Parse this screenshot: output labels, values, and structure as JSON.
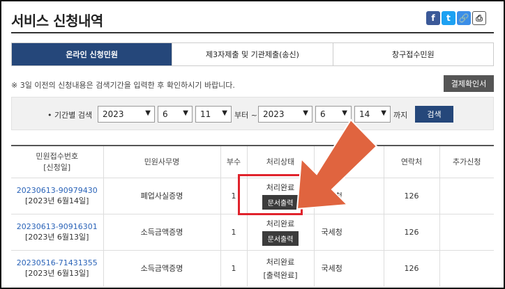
{
  "page": {
    "title": "서비스 신청내역"
  },
  "share": {
    "facebook_icon": "f",
    "twitter_icon": "t",
    "link_icon": "🔗",
    "print_icon": "⎙"
  },
  "tabs": [
    {
      "label": "온라인 신청민원",
      "active": true
    },
    {
      "label": "제3자제출 및 기관제출(송신)",
      "active": false
    },
    {
      "label": "창구접수민원",
      "active": false
    }
  ],
  "notice": "※ 3일 이전의 신청내용은 검색기간을 입력한 후 확인하시기 바랍니다.",
  "receipt_button": "결제확인서",
  "search": {
    "label": "• 기간별 검색",
    "start_year": "2023",
    "start_month": "6",
    "start_day": "11",
    "from_label": "부터 ~",
    "end_year": "2023",
    "end_month": "6",
    "end_day": "14",
    "to_label": "까지",
    "button": "검색"
  },
  "table": {
    "headers": [
      "민원접수번호",
      "[신청일]",
      "민원사무명",
      "부수",
      "처리상태",
      "부기관",
      "연락처",
      "추가신청"
    ],
    "rows": [
      {
        "app_no": "20230613-90979430",
        "date": "[2023년 6월14일]",
        "name": "폐업사실증명",
        "copies": "1",
        "status": "처리완료",
        "action": "문서출력",
        "agency": "국세청",
        "contact": "126",
        "extra": ""
      },
      {
        "app_no": "20230613-90916301",
        "date": "[2023년 6월13일]",
        "name": "소득금액증명",
        "copies": "1",
        "status": "처리완료",
        "action": "문서출력",
        "agency": "국세청",
        "contact": "126",
        "extra": ""
      },
      {
        "app_no": "20230516-71431355",
        "date": "[2023년 6월13일]",
        "name": "소득금액증명",
        "copies": "1",
        "status": "처리완료",
        "action": "[출력완료]",
        "agency": "국세청",
        "contact": "126",
        "extra": ""
      }
    ]
  },
  "annotation_colors": {
    "highlight": "#e0232c",
    "arrow": "#e0643f"
  }
}
